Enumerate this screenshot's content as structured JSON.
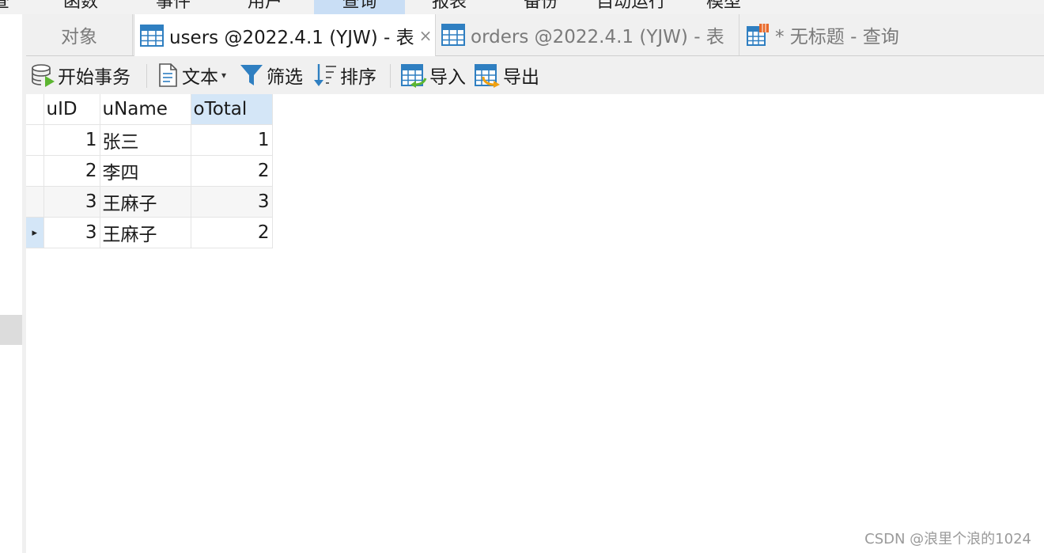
{
  "menu": {
    "items": [
      "查",
      "函数",
      "事件",
      "用户",
      "查询",
      "报表",
      "备份",
      "自动运行",
      "模型"
    ],
    "active_index": 4
  },
  "tabs": {
    "objects_label": "对象",
    "items": [
      {
        "label": "users @2022.4.1 (YJW) - 表",
        "icon": "table-icon",
        "active": true,
        "close": "×"
      },
      {
        "label": "orders @2022.4.1 (YJW) - 表",
        "icon": "table-icon",
        "active": false
      },
      {
        "label": "* 无标题 - 查询",
        "icon": "query-icon",
        "active": false
      }
    ]
  },
  "toolbar": {
    "begin_transaction": "开始事务",
    "text": "文本",
    "filter": "筛选",
    "sort": "排序",
    "import": "导入",
    "export": "导出"
  },
  "grid": {
    "columns": [
      "uID",
      "uName",
      "oTotal"
    ],
    "selected_column": "oTotal",
    "rows": [
      {
        "uID": "1",
        "uName": "张三",
        "oTotal": "1"
      },
      {
        "uID": "2",
        "uName": "李四",
        "oTotal": "2"
      },
      {
        "uID": "3",
        "uName": "王麻子",
        "oTotal": "3"
      },
      {
        "uID": "3",
        "uName": "王麻子",
        "oTotal": "2"
      }
    ],
    "current_row_marker": "▸"
  },
  "watermark": "CSDN @浪里个浪的1024",
  "colors": {
    "accent": "#d4e6f7",
    "toolbar_bg": "#f0f0f0",
    "icon_blue": "#2f7fc1",
    "icon_green": "#5cb531",
    "icon_orange": "#f0a010"
  }
}
